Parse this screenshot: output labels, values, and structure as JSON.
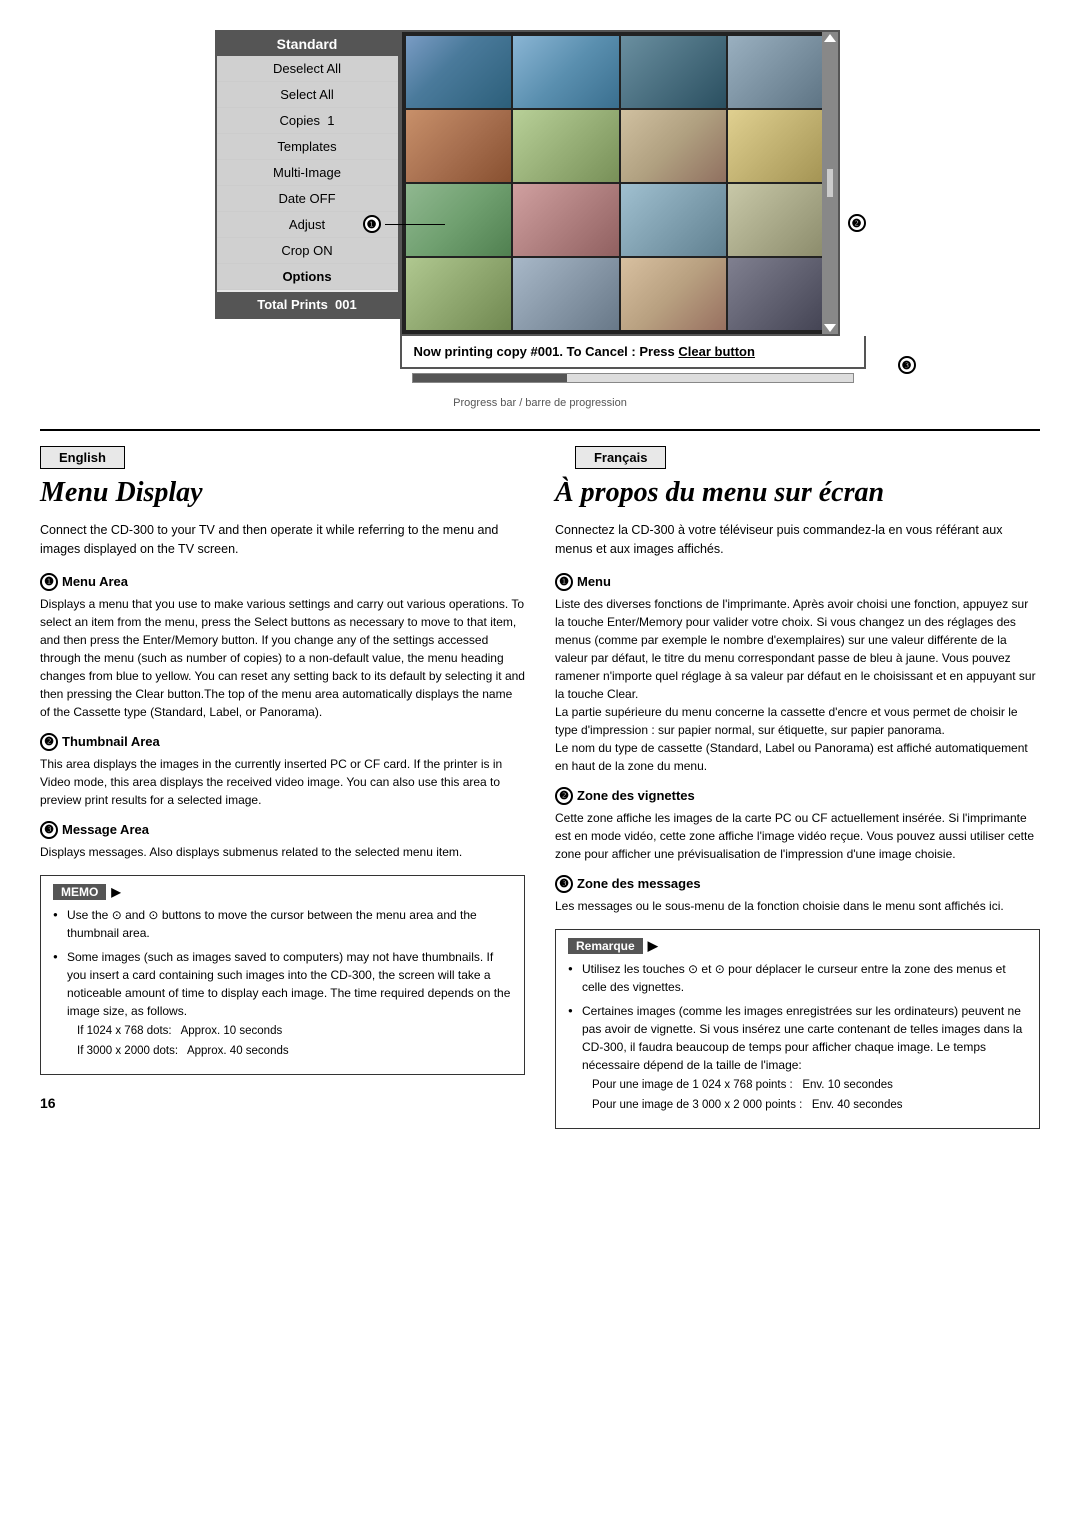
{
  "page": {
    "number": "16"
  },
  "diagram": {
    "menu_panel": {
      "title": "Standard",
      "items": [
        {
          "label": "Deselect All",
          "bold": false
        },
        {
          "label": "Select All",
          "bold": false
        },
        {
          "label": "Copies  1",
          "bold": false
        },
        {
          "label": "Templates",
          "bold": false
        },
        {
          "label": "Multi-Image",
          "bold": false
        },
        {
          "label": "Date OFF",
          "bold": false
        },
        {
          "label": "Adjust",
          "bold": false
        },
        {
          "label": "Crop ON",
          "bold": false
        },
        {
          "label": "Options",
          "bold": true
        }
      ],
      "footer": "Total Prints  001"
    },
    "message_bar": {
      "text": "Now printing copy #001. To Cancel : Press Clear button"
    },
    "progress_label": "Progress bar / barre de progression",
    "callout_1_label": "❶",
    "callout_2_label": "❷",
    "callout_3_label": "❸"
  },
  "english": {
    "lang_tab": "English",
    "heading": "Menu Display",
    "intro": "Connect the CD-300 to your TV and then operate it while referring to the menu and images displayed on the TV screen.",
    "subsections": [
      {
        "id": "1",
        "title": "Menu Area",
        "body": "Displays a menu that you use to make various settings and carry out various operations. To select an item from the menu, press the Select buttons as necessary to move to that item, and then press the Enter/Memory button. If you change any of the settings accessed through the menu (such as number of copies) to a non-default value, the menu heading changes from blue to yellow. You can reset any setting back to its default by selecting it and then pressing the Clear button.The top of the menu area automatically displays the name of the Cassette type (Standard, Label, or Panorama)."
      },
      {
        "id": "2",
        "title": "Thumbnail Area",
        "body": "This area displays the images in the currently inserted PC or CF card. If the printer is in Video mode, this area displays the received video image. You can also use this area to preview print results for a selected image."
      },
      {
        "id": "3",
        "title": "Message Area",
        "body": "Displays messages. Also displays submenus related to the selected menu item."
      }
    ],
    "memo": {
      "title": "MEMO",
      "items": [
        {
          "text": "Use the ⊙ and ⊙ buttons to move the cursor between the menu area and the thumbnail area."
        },
        {
          "text": "Some images (such as images saved to computers) may not have thumbnails. If you insert a card containing such images into the CD-300, the screen will take a noticeable amount of time to display each image. The time required depends on the image size, as follows.",
          "sub_items": [
            "If 1024 x 768 dots:  Approx. 10 seconds",
            "If 3000 x 2000 dots:  Approx. 40 seconds"
          ]
        }
      ]
    }
  },
  "francais": {
    "lang_tab": "Français",
    "heading": "À propos du menu sur écran",
    "intro": "Connectez la CD-300 à votre téléviseur puis commandez-la en vous référant aux menus et aux images affichés.",
    "subsections": [
      {
        "id": "1",
        "title": "Menu",
        "body": "Liste des diverses fonctions de l'imprimante. Après avoir choisi une fonction, appuyez sur la touche Enter/Memory pour valider votre choix. Si vous changez un des réglages des menus (comme par exemple le nombre d'exemplaires) sur une valeur différente de la valeur par défaut, le titre du menu correspondant passe de bleu à jaune. Vous pouvez ramener n'importe quel réglage à sa valeur par défaut en le choisissant et en appuyant sur la touche Clear.\nLa partie supérieure du menu concerne la cassette d'encre et vous permet de choisir le type d'impression : sur papier normal, sur étiquette, sur papier panorama.\nLe nom du type de cassette (Standard, Label ou Panorama) est affiché automatiquement en haut de la zone du menu."
      },
      {
        "id": "2",
        "title": "Zone des vignettes",
        "body": "Cette zone affiche les images de la carte PC ou CF actuellement insérée. Si l'imprimante est en mode vidéo, cette zone affiche l'image vidéo reçue. Vous pouvez aussi utiliser cette zone pour afficher une prévisualisation de l'impression d'une image choisie."
      },
      {
        "id": "3",
        "title": "Zone des messages",
        "body": "Les messages ou le sous-menu de la fonction choisie dans le menu sont affichés ici."
      }
    ],
    "remarque": {
      "title": "Remarque",
      "items": [
        {
          "text": "Utilisez les touches ⊙ et ⊙ pour déplacer le curseur entre la zone des menus et celle des vignettes."
        },
        {
          "text": "Certaines images (comme les images enregistrées sur les ordinateurs) peuvent ne pas avoir de vignette. Si vous insérez une carte contenant de telles images dans la CD-300, il faudra beaucoup de temps pour afficher chaque image. Le temps nécessaire dépend de la taille de l'image:",
          "sub_items": [
            "Pour une image de 1 024 x 768 points :  Env. 10 secondes",
            "Pour une image de 3 000 x 2 000 points :  Env. 40 secondes"
          ]
        }
      ]
    }
  }
}
